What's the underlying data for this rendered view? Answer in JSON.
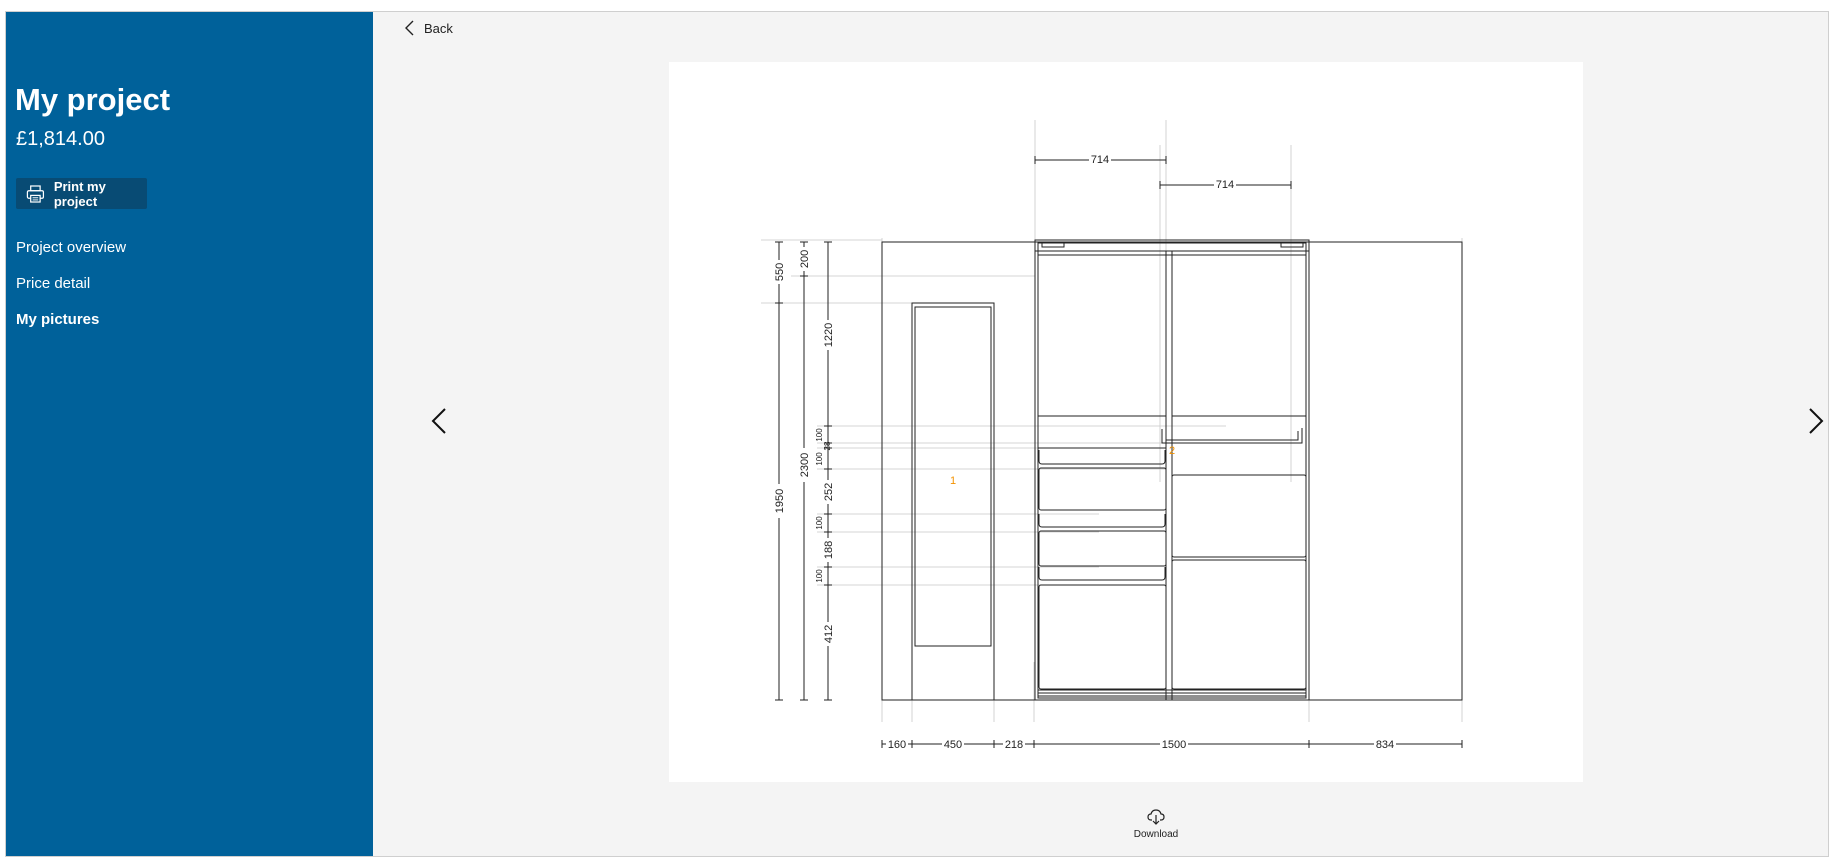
{
  "sidebar": {
    "title": "My project",
    "price": "£1,814.00",
    "print_label": "Print my project",
    "nav": {
      "overview": "Project overview",
      "price_detail": "Price detail",
      "pictures": "My pictures"
    }
  },
  "main": {
    "back_label": "Back",
    "download_label": "Download"
  },
  "drawing": {
    "dimensions_top": [
      "714",
      "714"
    ],
    "dimensions_bottom": [
      "160",
      "450",
      "218",
      "1500",
      "834"
    ],
    "dimensions_left": {
      "outer": [
        "550",
        "1950"
      ],
      "middle": [
        "200",
        "2300"
      ],
      "inner": [
        "1220",
        "100",
        "28",
        "100",
        "252",
        "100",
        "188",
        "100",
        "412"
      ]
    },
    "markers": [
      "1",
      "2"
    ]
  },
  "colors": {
    "sidebar_bg": "#00619a",
    "print_button_bg": "#084b74",
    "canvas_bg": "#f4f4f4",
    "marker": "#f39200"
  },
  "icons": {
    "print": "printer-icon",
    "back": "chevron-left-icon",
    "prev": "chevron-left-icon",
    "next": "chevron-right-icon",
    "download": "cloud-download-icon"
  }
}
